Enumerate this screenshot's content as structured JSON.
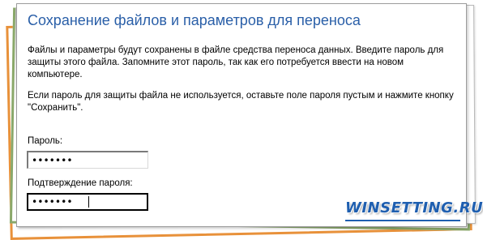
{
  "dialog": {
    "title": "Сохранение файлов и параметров для переноса",
    "paragraph1": "Файлы и параметры будут сохранены в файле средства переноса данных. Введите пароль для защиты этого файла. Запомните этот пароль, так как его потребуется ввести на новом компьютере.",
    "paragraph2": "Если пароль для защиты файла не используется, оставьте поле пароля пустым и нажмите кнопку \"Сохранить\".",
    "password_label": "Пароль:",
    "password_value": "•••••••",
    "confirm_label": "Подтверждение пароля:",
    "confirm_value": "•••••••"
  },
  "watermark": {
    "text": "WINSETTING.RU"
  },
  "colors": {
    "title": "#2a5fa8",
    "frame_orange": "#e8913a",
    "frame_green": "#8aa86a",
    "watermark": "#1f5fb0"
  }
}
